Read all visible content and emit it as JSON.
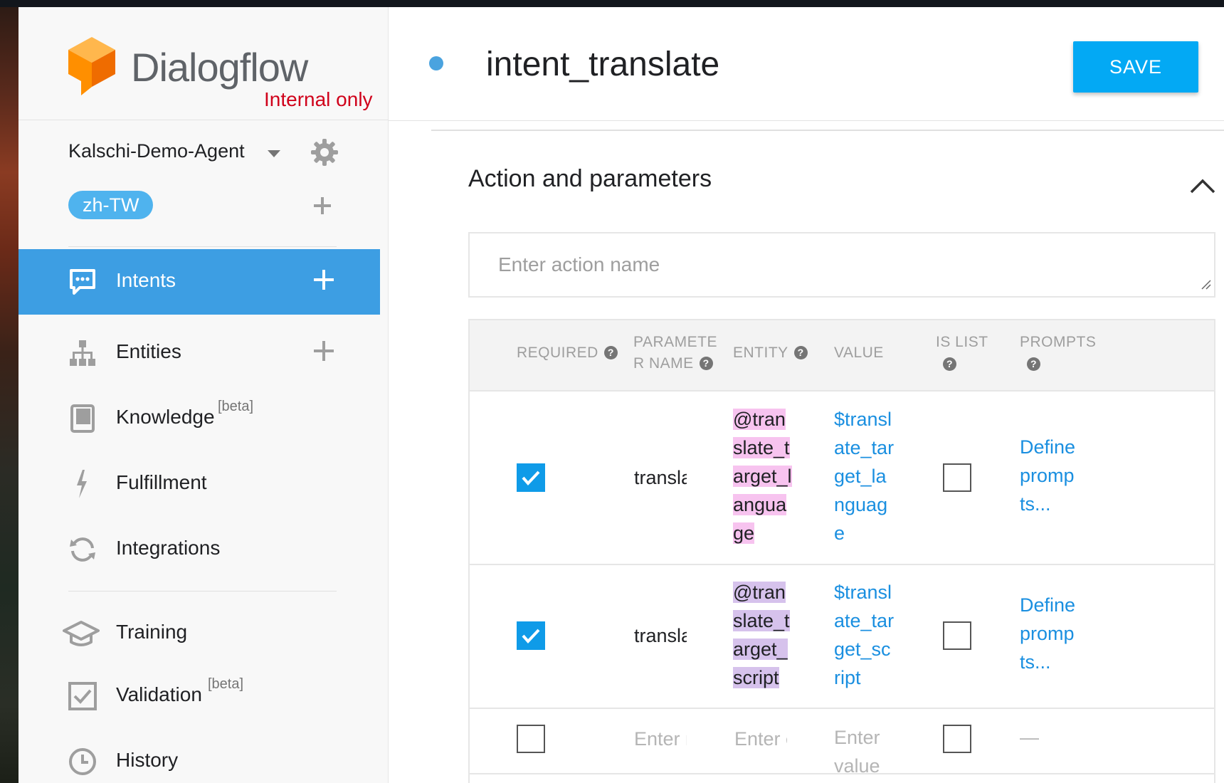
{
  "brand": {
    "name": "Dialogflow",
    "note": "Internal only",
    "logo_color": "#ff9800"
  },
  "agent": {
    "name": "Kalschi-Demo-Agent",
    "language": "zh-TW"
  },
  "nav": [
    {
      "label": "Intents",
      "beta": "",
      "icon": "chat-icon",
      "has_add": true,
      "active": true
    },
    {
      "label": "Entities",
      "beta": "",
      "icon": "hierarchy-icon",
      "has_add": true
    },
    {
      "label": "Knowledge",
      "beta": "[beta]",
      "icon": "book-icon"
    },
    {
      "label": "Fulfillment",
      "beta": "",
      "icon": "bolt-icon"
    },
    {
      "label": "Integrations",
      "beta": "",
      "icon": "sync-icon"
    },
    {
      "label": "Training",
      "beta": "",
      "icon": "graduation-cap-icon"
    },
    {
      "label": "Validation",
      "beta": "[beta]",
      "icon": "checkbox-icon"
    },
    {
      "label": "History",
      "beta": "",
      "icon": "clock-icon"
    }
  ],
  "intent": {
    "title": "intent_translate",
    "save_label": "SAVE"
  },
  "section": {
    "title": "Action and parameters",
    "action_placeholder": "Enter action name"
  },
  "table": {
    "headers": {
      "required": "REQUIRED",
      "param_line1": "PARAMETE",
      "param_line2": "R NAME",
      "entity": "ENTITY",
      "value": "VALUE",
      "is_list": "IS LIST",
      "prompts": "PROMPTS"
    },
    "help_glyph": "?",
    "rows": [
      {
        "required": true,
        "name": "translate_target_language",
        "entity": "@translate_target_language",
        "value": "$translate_target_language",
        "is_list": false,
        "prompts": "Define prompts..."
      },
      {
        "required": true,
        "name": "translate_target_script",
        "entity": "@translate_target_script",
        "value": "$translate_target_script",
        "is_list": false,
        "prompts": "Define prompts..."
      }
    ],
    "empty_row": {
      "name_placeholder": "Enter name",
      "entity_placeholder": "Enter entity",
      "value_placeholder": "Enter value",
      "prompts": "—"
    }
  },
  "colors": {
    "accent": "#3d9ee3",
    "save": "#03a9f4",
    "entity_pink": "#f7c3ef",
    "entity_purple": "#d6c2ec",
    "link": "#1a8fe0"
  }
}
